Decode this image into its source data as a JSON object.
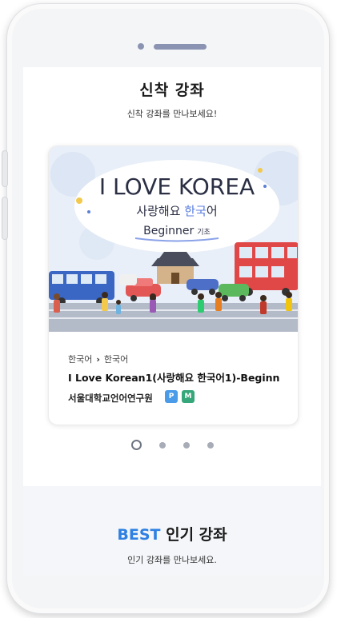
{
  "new_courses": {
    "title": "신착 강좌",
    "subtitle": "신착 강좌를 만나보세요!"
  },
  "featured_course": {
    "image": {
      "headline": "I LOVE KOREA",
      "korean_prefix": "사랑해요 ",
      "korean_accent": "한국",
      "korean_suffix": "어",
      "level": "Beginner",
      "level_korean": "기초"
    },
    "category": "한국어",
    "subcategory": "한국어",
    "title": "I Love Korean1(사랑해요 한국어1)-Beginn",
    "provider": "서울대학교언어연구원",
    "badges": [
      "P",
      "M"
    ]
  },
  "carousel": {
    "count": 4,
    "active_index": 0
  },
  "best_courses": {
    "title_accent": "BEST",
    "title_rest": " 인기 강좌",
    "subtitle": "인기 강좌를 만나보세요."
  },
  "colors": {
    "accent_blue": "#2e80e2",
    "badge_p": "#4a9be8",
    "badge_m": "#36a77a",
    "dot_inactive": "#a7acb6"
  }
}
